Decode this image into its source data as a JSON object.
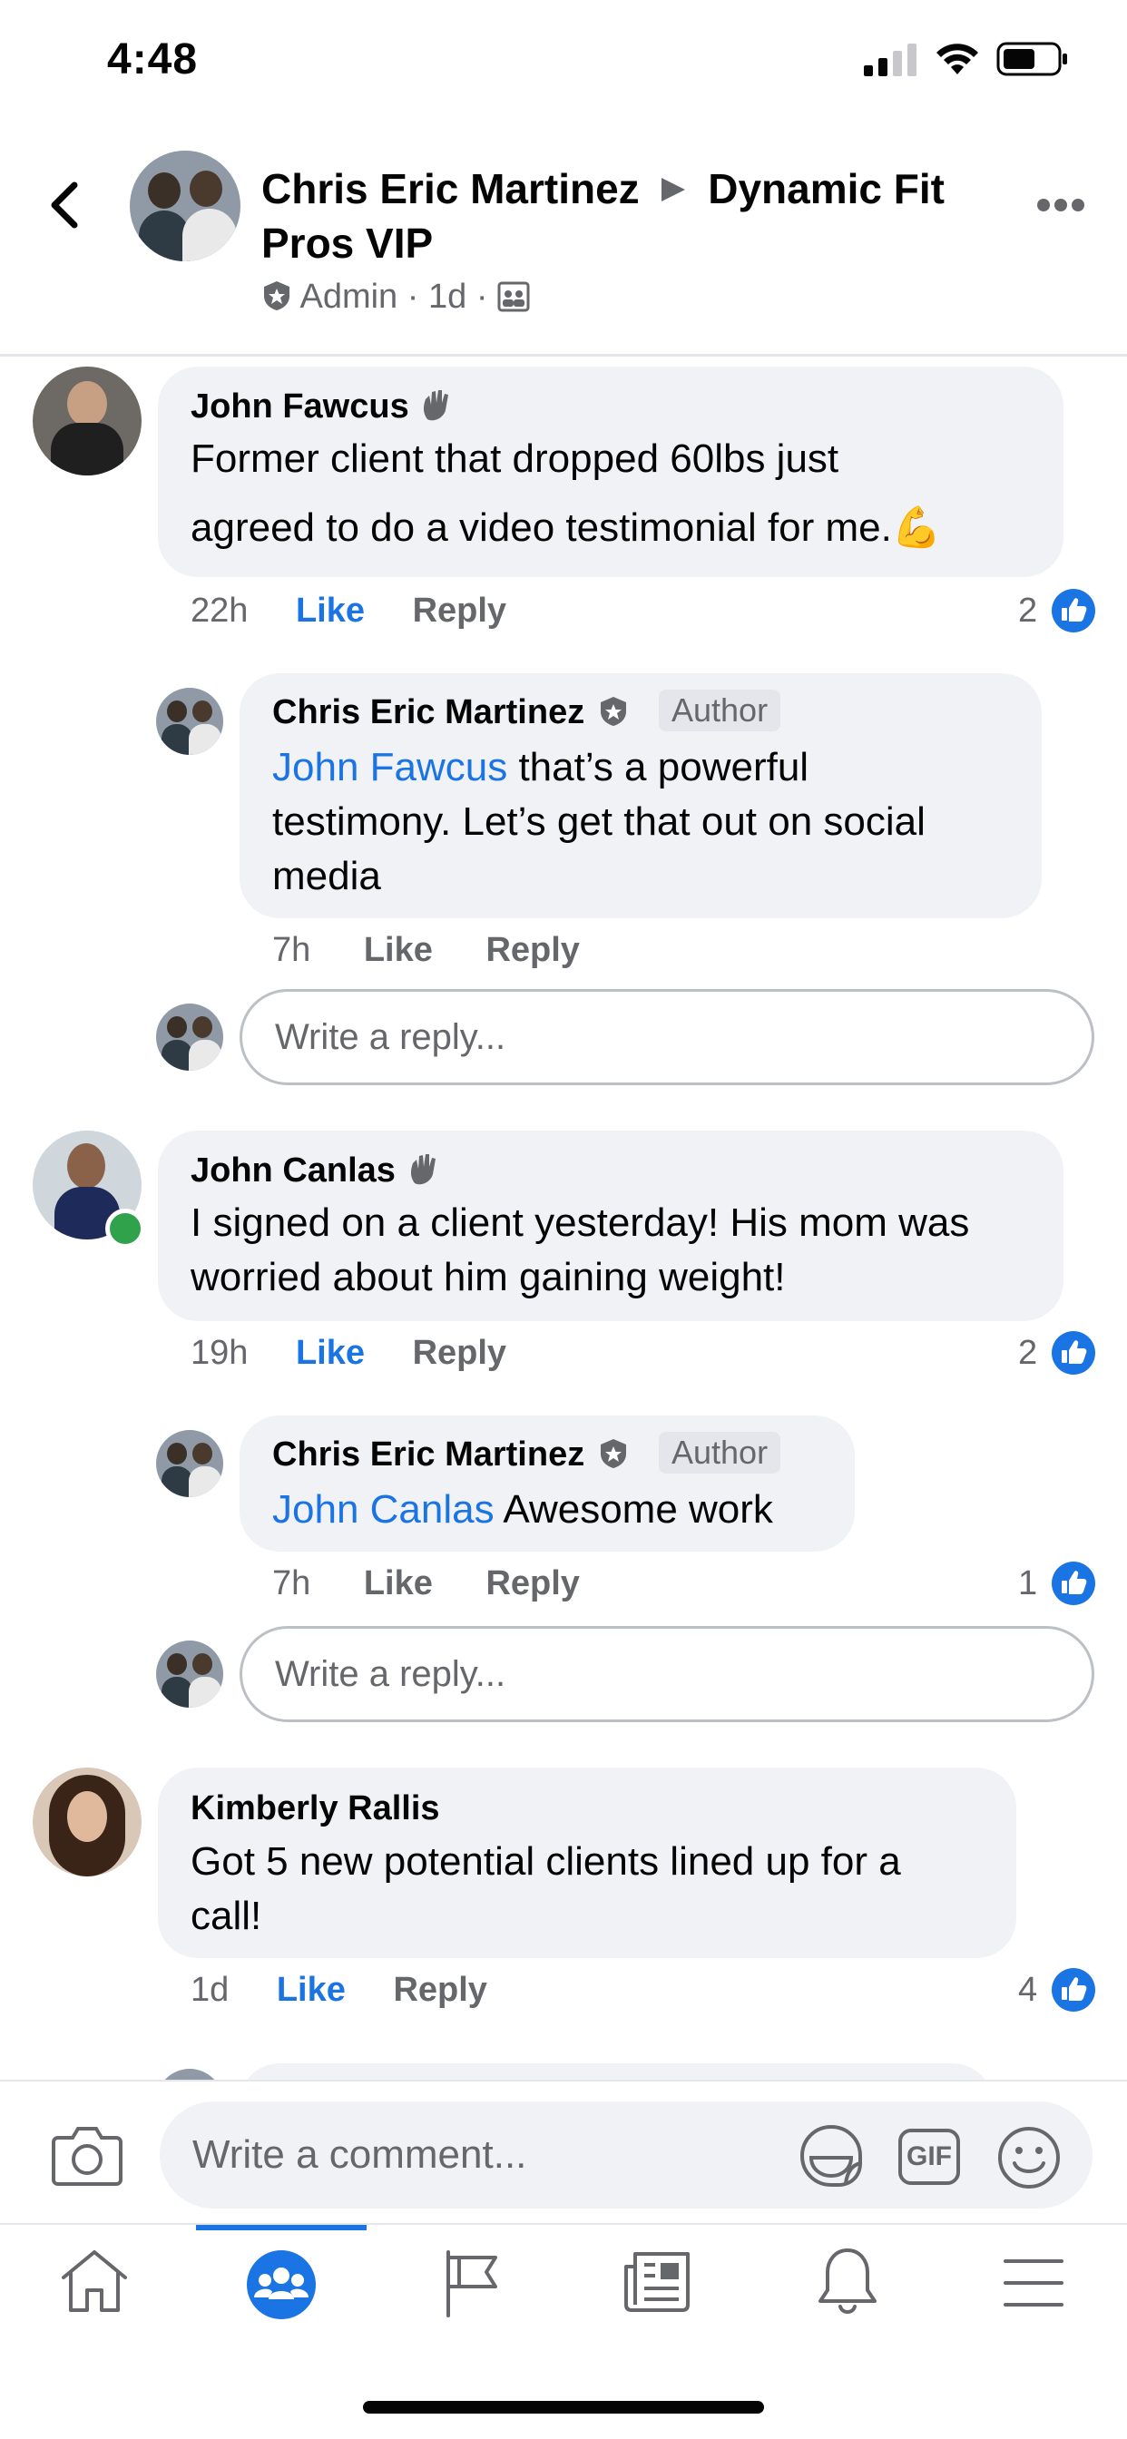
{
  "status_bar": {
    "time": "4:48"
  },
  "header": {
    "author": "Chris Eric Martinez",
    "separator_icon": "triangle-right-icon",
    "group_line1": "Dynamic Fit",
    "group_line2": "Pros VIP",
    "role": "Admin",
    "age": "1d",
    "dot": "·",
    "privacy_icon": "group-members-icon",
    "more_icon": "more-options-icon",
    "back_icon": "back-chevron-icon"
  },
  "comments": [
    {
      "name": "John Fawcus",
      "badge_icon": "waving-hand-icon",
      "text_line1": "Former client that dropped 60lbs just",
      "text_line2": "agreed to do a video testimonial for me.",
      "emoji": "💪",
      "time": "22h",
      "like": "Like",
      "reply": "Reply",
      "likes": "2",
      "replies": [
        {
          "name": "Chris Eric Martinez",
          "badge": "Author",
          "mention": "John Fawcus",
          "text_line1": " that’s a powerful",
          "text_line2": "testimony. Let’s get that out on social",
          "text_line3": "media",
          "time": "7h",
          "like": "Like",
          "reply": "Reply"
        }
      ],
      "reply_placeholder": "Write a reply..."
    },
    {
      "name": "John Canlas",
      "badge_icon": "waving-hand-icon",
      "text_line1": "I signed on a client yesterday! His mom was",
      "text_line2": "worried about him gaining weight!",
      "time": "19h",
      "like": "Like",
      "reply": "Reply",
      "likes": "2",
      "replies": [
        {
          "name": "Chris Eric Martinez",
          "badge": "Author",
          "mention": "John Canlas",
          "text_line1": " Awesome work",
          "time": "7h",
          "like": "Like",
          "reply": "Reply",
          "likes": "1"
        }
      ],
      "reply_placeholder": "Write a reply..."
    },
    {
      "name": "Kimberly Rallis",
      "text_line1": "Got 5 new potential clients lined up for a",
      "text_line2": "call!",
      "time": "1d",
      "like": "Like",
      "reply": "Reply",
      "likes": "4"
    }
  ],
  "composer": {
    "placeholder": "Write a comment...",
    "camera_icon": "camera-icon",
    "sticker_icon": "sticker-icon",
    "gif_label": "GIF",
    "emoji_icon": "smiley-icon"
  },
  "tab_bar": {
    "tabs": [
      "home-icon",
      "groups-icon",
      "pages-flag-icon",
      "news-icon",
      "notifications-bell-icon",
      "menu-icon"
    ],
    "active": "groups-icon"
  },
  "colors": {
    "accent": "#1b74e4",
    "bubble": "#f0f2f5",
    "secondary_text": "#65676b"
  }
}
